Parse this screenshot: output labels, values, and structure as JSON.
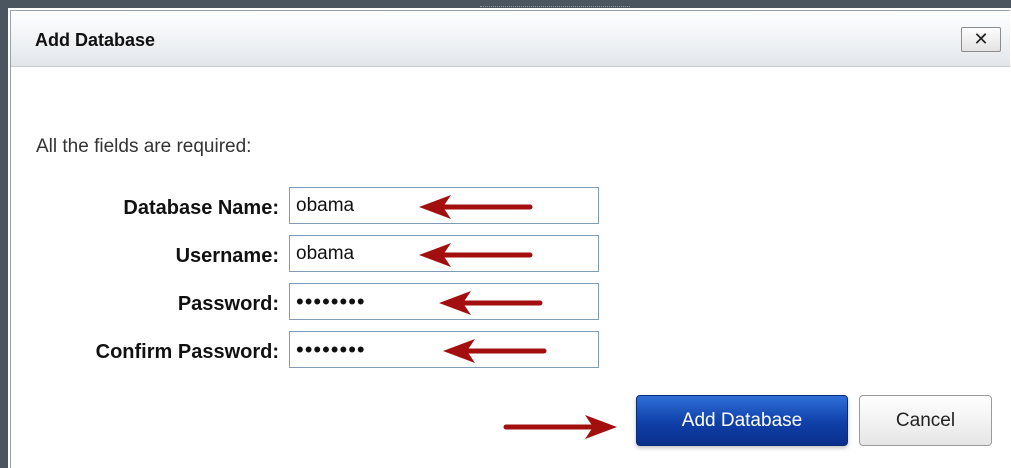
{
  "dialog": {
    "title": "Add Database",
    "close_label": "✕",
    "intro": "All the fields are required:"
  },
  "form": {
    "fields": [
      {
        "label": "Database Name:",
        "value": "obama"
      },
      {
        "label": "Username:",
        "value": "obama"
      },
      {
        "label": "Password:",
        "value": "••••••••"
      },
      {
        "label": "Confirm Password:",
        "value": "••••••••"
      }
    ]
  },
  "buttons": {
    "primary_label": "Add Database",
    "cancel_label": "Cancel"
  },
  "colors": {
    "primary_button": "#1448b8",
    "annotation_arrow": "#a30f0f",
    "input_border": "#7f9db9"
  },
  "icons": {
    "close": "close-icon",
    "annotation": "red-arrow-icon"
  }
}
